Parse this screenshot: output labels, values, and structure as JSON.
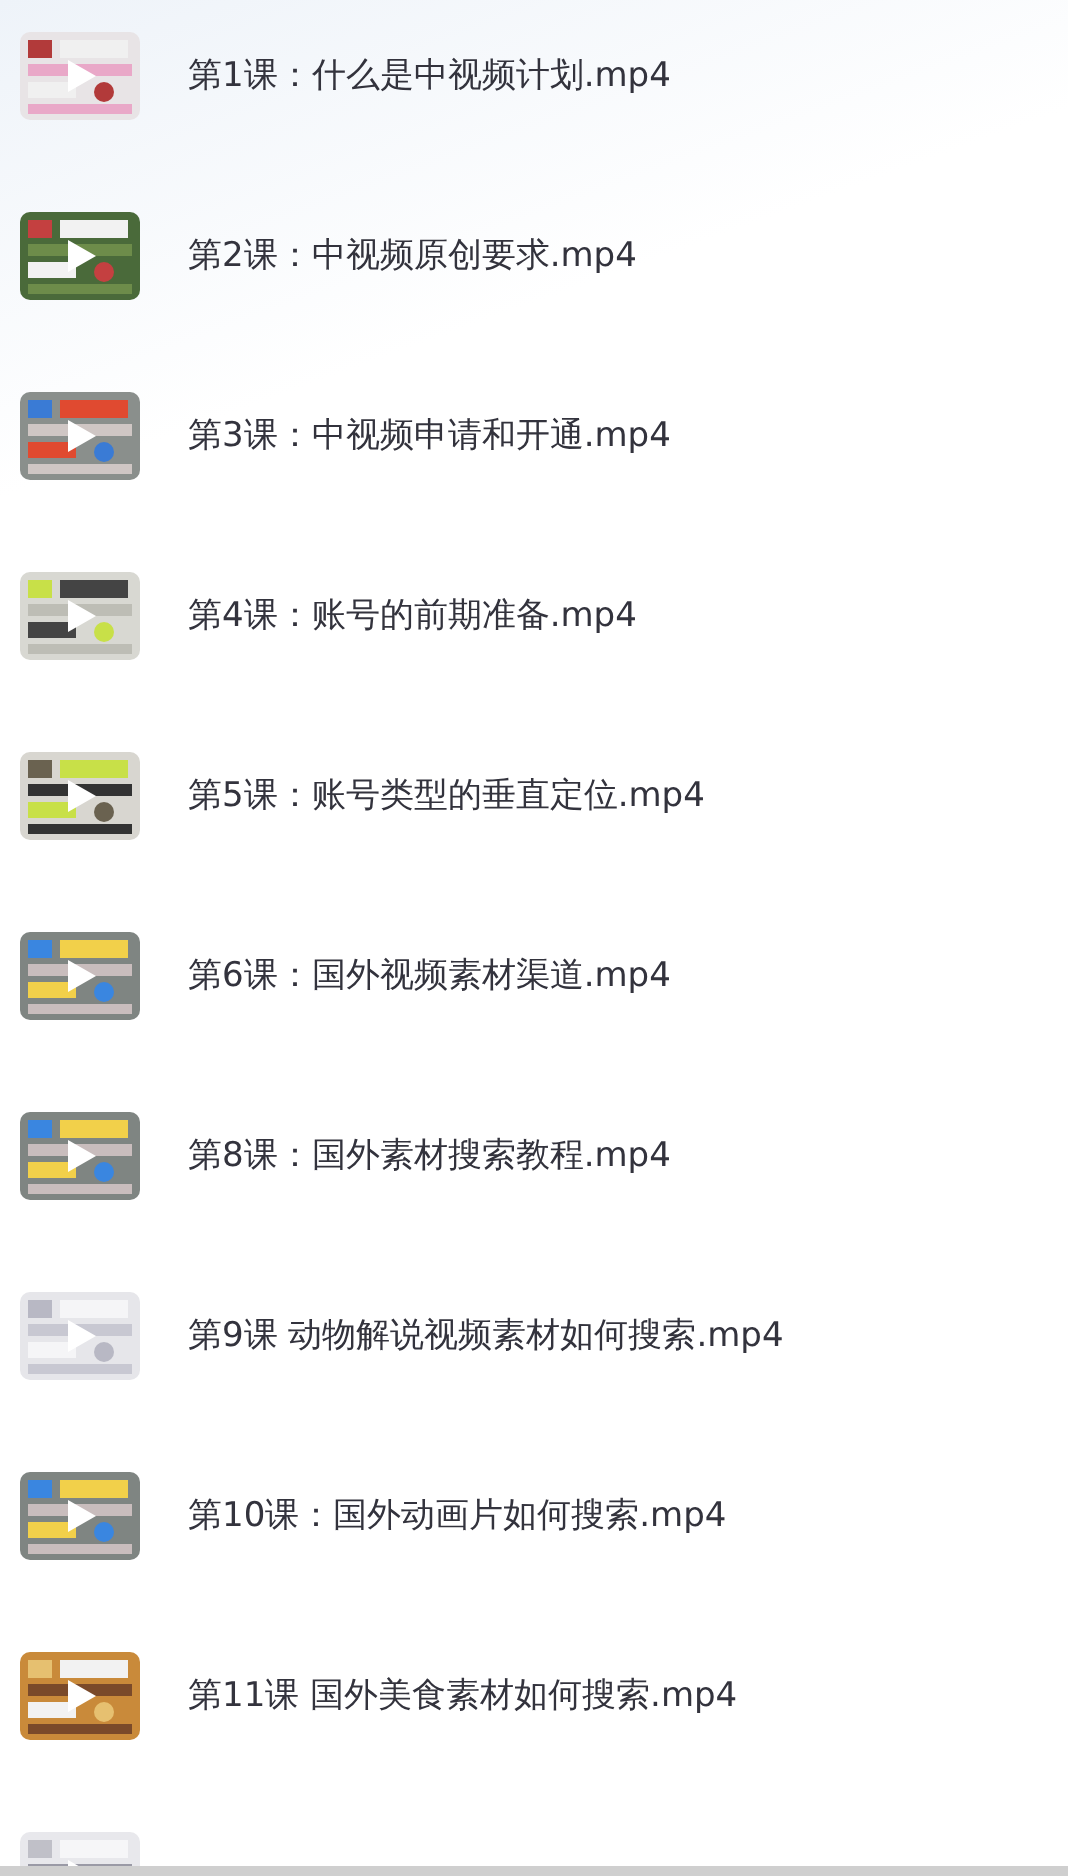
{
  "lessons": [
    {
      "title": "第1课：什么是中视频计划.mp4"
    },
    {
      "title": "第2课：中视频原创要求.mp4"
    },
    {
      "title": "第3课：中视频申请和开通.mp4"
    },
    {
      "title": "第4课：账号的前期准备.mp4"
    },
    {
      "title": "第5课：账号类型的垂直定位.mp4"
    },
    {
      "title": "第6课：国外视频素材渠道.mp4"
    },
    {
      "title": "第8课：国外素材搜索教程.mp4"
    },
    {
      "title": "第9课 动物解说视频素材如何搜索.mp4"
    },
    {
      "title": "第10课：国外动画片如何搜索.mp4"
    },
    {
      "title": "第11课 国外美食素材如何搜索.mp4"
    },
    {
      "kind": "picture"
    }
  ]
}
